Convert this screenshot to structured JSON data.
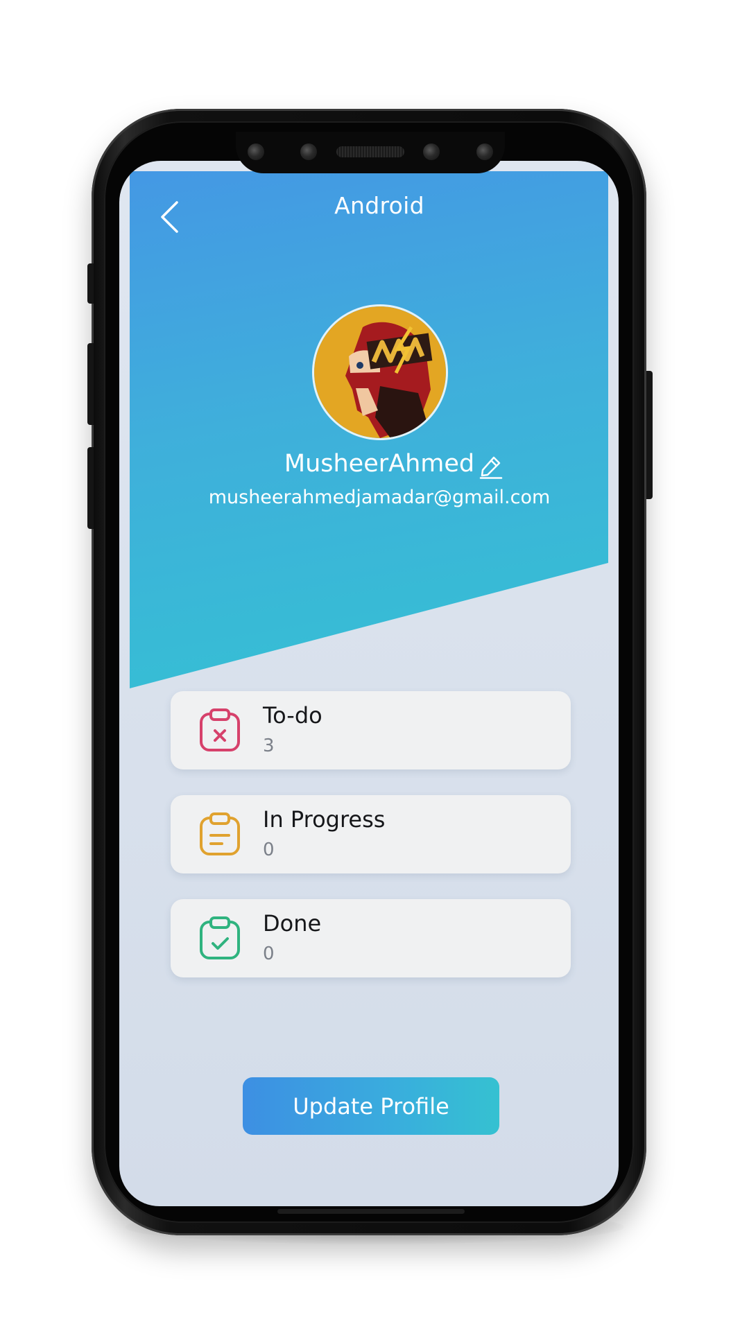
{
  "app": {
    "title": "Android"
  },
  "profile": {
    "name": "MusheerAhmed",
    "email": "musheerahmedjamadar@gmail.com"
  },
  "stats": [
    {
      "label": "To-do",
      "count": "3",
      "icon": "clipboard-x-icon",
      "color": "#d6416b"
    },
    {
      "label": "In Progress",
      "count": "0",
      "icon": "clipboard-list-icon",
      "color": "#e0a22f"
    },
    {
      "label": "Done",
      "count": "0",
      "icon": "clipboard-check-icon",
      "color": "#2fb37f"
    }
  ],
  "actions": {
    "update_label": "Update Profile"
  },
  "colors": {
    "header_gradient_start": "#4498e4",
    "header_gradient_end": "#34c1d3",
    "screen_background": "#dfe6f0",
    "card_background": "#f0f1f2"
  },
  "icons": {
    "back": "chevron-left-icon",
    "edit": "pencil-icon",
    "avatar": "flash-avatar"
  }
}
